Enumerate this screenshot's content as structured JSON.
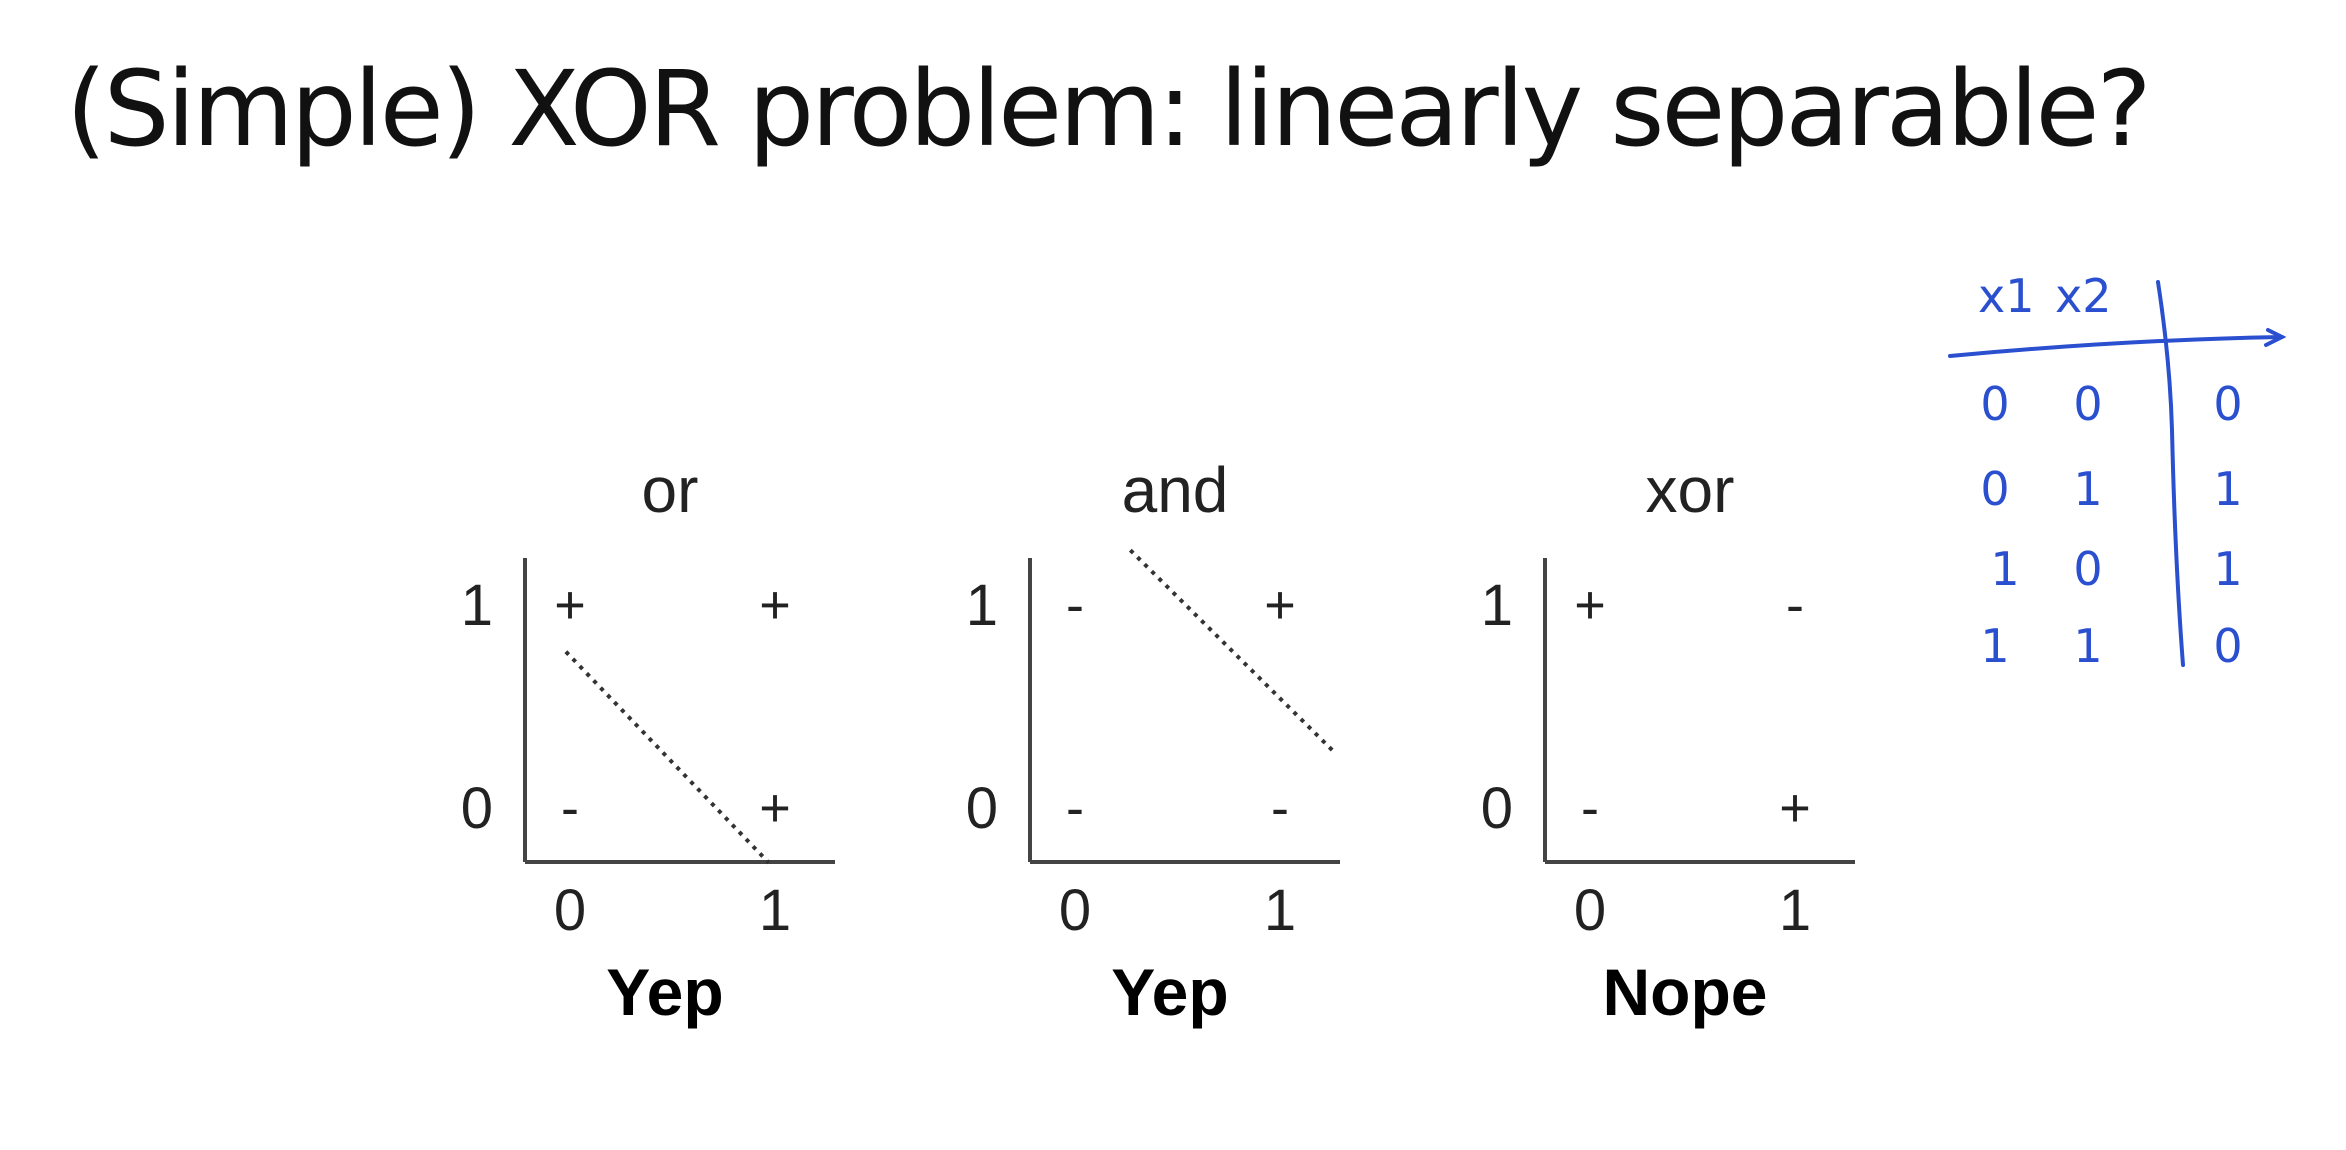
{
  "title": "(Simple) XOR problem: linearly separable?",
  "ink_color": "#2a4fcf",
  "plots": [
    {
      "name": "or",
      "title": "or",
      "verdict": "Yep",
      "x_ticks": [
        "0",
        "1"
      ],
      "y_ticks": [
        "0",
        "1"
      ],
      "points": [
        {
          "x": 0,
          "y": 0,
          "label": "-"
        },
        {
          "x": 0,
          "y": 1,
          "label": "+"
        },
        {
          "x": 1,
          "y": 0,
          "label": "+"
        },
        {
          "x": 1,
          "y": 1,
          "label": "+"
        }
      ],
      "separator": [
        [
          -0.02,
          0.77
        ],
        [
          0.97,
          -0.27
        ]
      ]
    },
    {
      "name": "and",
      "title": "and",
      "verdict": "Yep",
      "x_ticks": [
        "0",
        "1"
      ],
      "y_ticks": [
        "0",
        "1"
      ],
      "points": [
        {
          "x": 0,
          "y": 0,
          "label": "-"
        },
        {
          "x": 0,
          "y": 1,
          "label": "-"
        },
        {
          "x": 1,
          "y": 0,
          "label": "-"
        },
        {
          "x": 1,
          "y": 1,
          "label": "+"
        }
      ],
      "separator": [
        [
          0.27,
          1.27
        ],
        [
          1.27,
          0.27
        ]
      ]
    },
    {
      "name": "xor",
      "title": "xor",
      "verdict": "Nope",
      "x_ticks": [
        "0",
        "1"
      ],
      "y_ticks": [
        "0",
        "1"
      ],
      "points": [
        {
          "x": 0,
          "y": 0,
          "label": "-"
        },
        {
          "x": 0,
          "y": 1,
          "label": "+"
        },
        {
          "x": 1,
          "y": 0,
          "label": "+"
        },
        {
          "x": 1,
          "y": 1,
          "label": "-"
        }
      ],
      "separator": null
    }
  ],
  "truth_table": {
    "headers": [
      "x1",
      "x2"
    ],
    "rows": [
      [
        "0",
        "0",
        "0"
      ],
      [
        "0",
        "1",
        "1"
      ],
      [
        "1",
        "0",
        "1"
      ],
      [
        "1",
        "1",
        "0"
      ]
    ]
  }
}
